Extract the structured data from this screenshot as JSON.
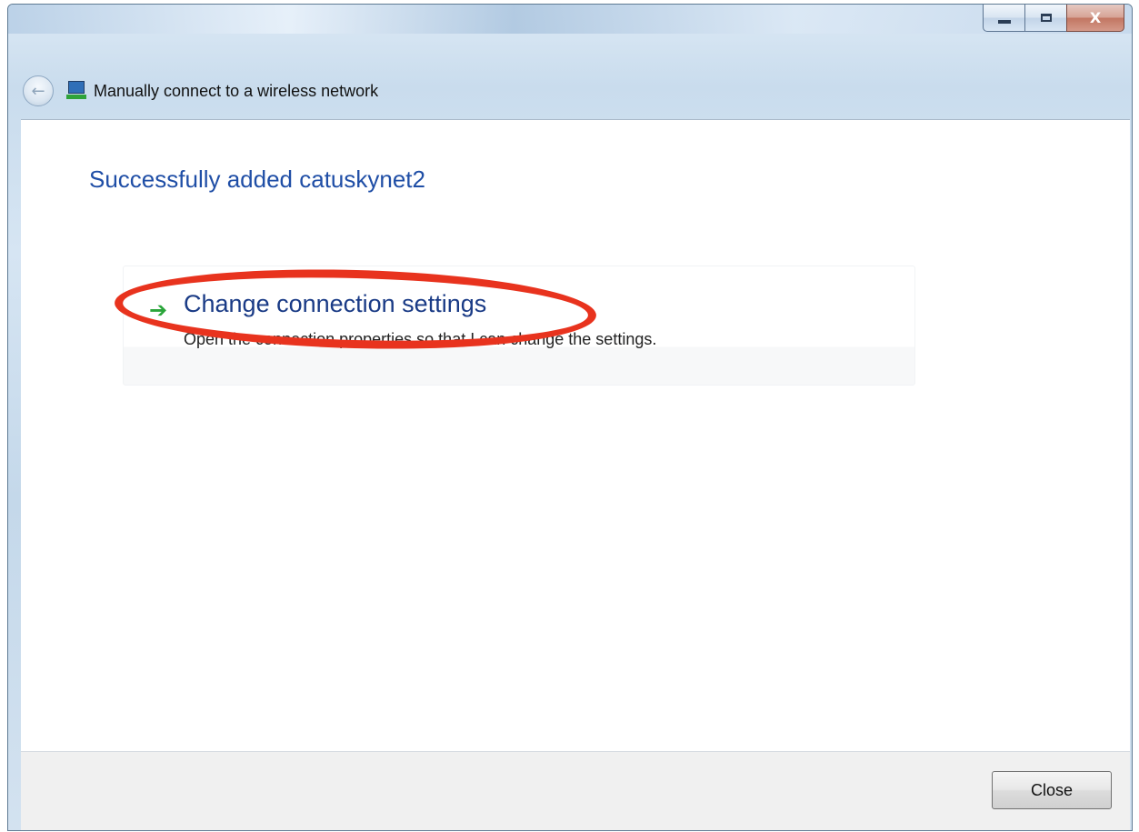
{
  "window": {
    "caption_buttons": {
      "minimize": "minimize-icon",
      "maximize": "maximize-icon",
      "close": "X"
    }
  },
  "nav": {
    "back_icon": "back-arrow-icon",
    "app_icon": "network-icon",
    "title": "Manually connect to a wireless network"
  },
  "main": {
    "heading": "Successfully added catuskynet2",
    "command_link": {
      "icon": "green-arrow-icon",
      "title": "Change connection settings",
      "description": "Open the connection properties so that I can change the settings."
    },
    "annotation": {
      "color": "#e8331e",
      "shape": "ellipse"
    }
  },
  "footer": {
    "close_label": "Close"
  },
  "colors": {
    "heading": "#1f4ea6",
    "link_title": "#1a3b86",
    "arrow": "#2aa53a"
  }
}
